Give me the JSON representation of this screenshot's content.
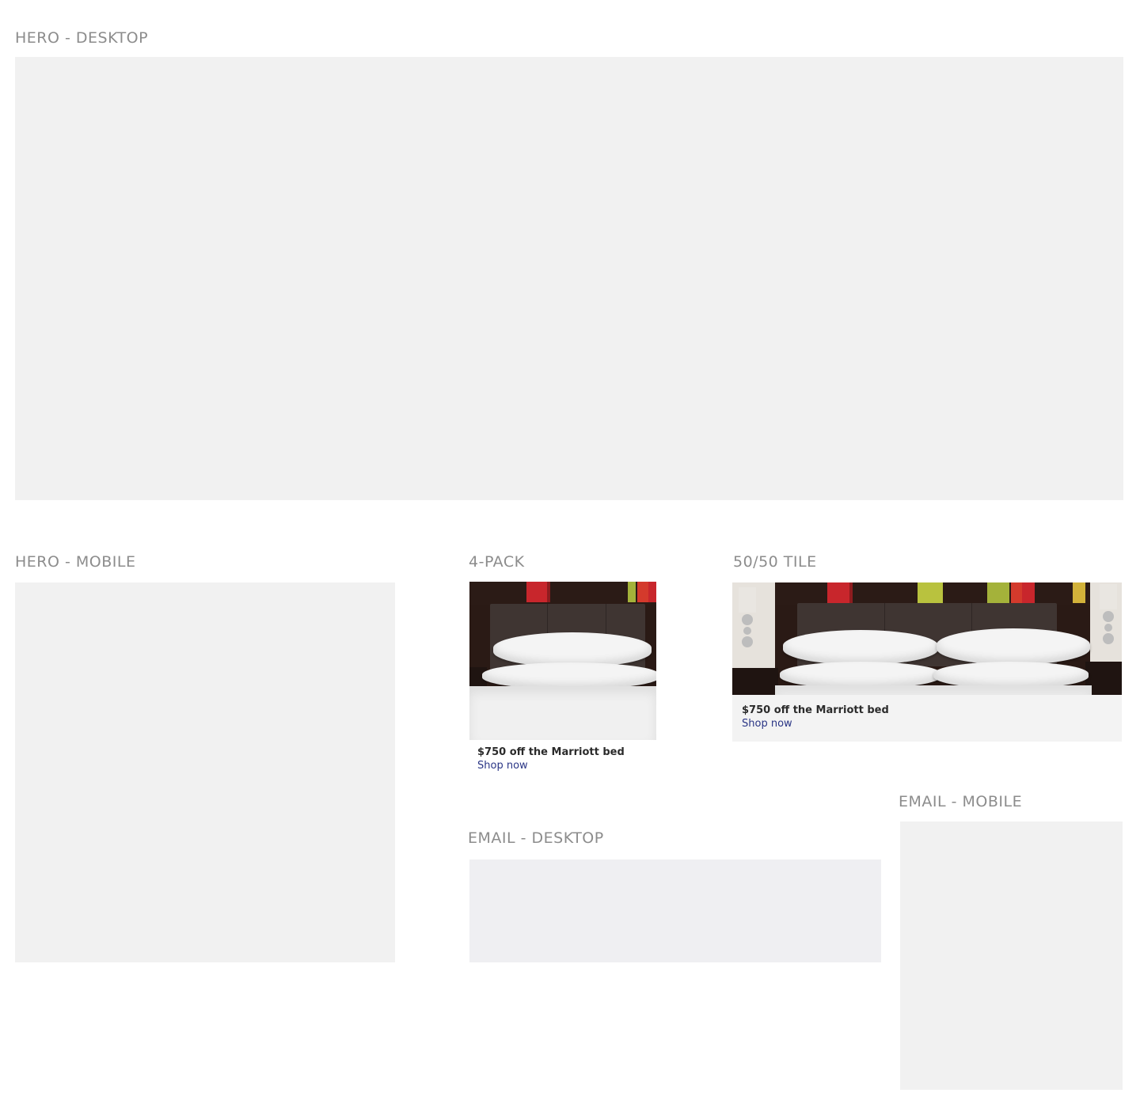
{
  "sections": {
    "hero_desktop": "HERO - DESKTOP",
    "hero_mobile": "HERO - MOBILE",
    "four_pack": "4-PACK",
    "fifty_tile": "50/50 TILE",
    "email_desktop": "EMAIL - DESKTOP",
    "email_mobile": "EMAIL - MOBILE"
  },
  "four_pack_card": {
    "title": "$750 off the Marriott bed",
    "link": "Shop now"
  },
  "fifty_tile_card": {
    "title": "$750 off the Marriott bed",
    "link": "Shop now"
  },
  "colors": {
    "label": "#8c8c8c",
    "placeholder": "#f1f1f1",
    "link": "#2a3585",
    "caption_text": "#2b2b2b"
  }
}
